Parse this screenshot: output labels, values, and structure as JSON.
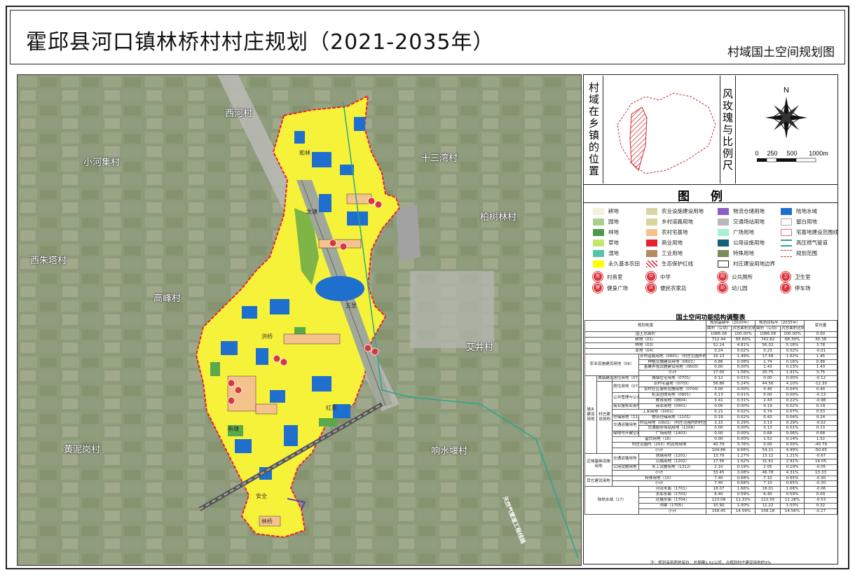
{
  "title": "霍邱县河口镇林桥村村庄规划（2021-2035年）",
  "subtitle": "村域国土空间规划图",
  "map": {
    "places": [
      "西河村",
      "小河集村",
      "十三湾村",
      "柏树林村",
      "西朱塔村",
      "高峰村",
      "艾井村",
      "黄泥岗村",
      "响水堰村"
    ],
    "inner_labels": [
      "和林",
      "龙塘",
      "五里",
      "洪桥",
      "新塘",
      "红星",
      "安全",
      "林桥"
    ],
    "highway_label": "天然气管道工程线路",
    "colors": {
      "farmland": "#ffff00",
      "water": "#1f6fcf",
      "forest": "#5aa94a",
      "homestead": "#f6c28b",
      "boundary": "#e8212e"
    }
  },
  "side": {
    "location_label": "村域在乡镇的位置",
    "compass_label": "风玫瑰与比例尺",
    "north": "N",
    "scale": [
      "0",
      "250",
      "500",
      "1000m"
    ]
  },
  "legend": {
    "title": "图例",
    "items": [
      {
        "label": "耕地",
        "color": "#f3f1d7"
      },
      {
        "label": "园地",
        "color": "#a7d08c"
      },
      {
        "label": "林地",
        "color": "#4d9a4d"
      },
      {
        "label": "草地",
        "color": "#c5e86c"
      },
      {
        "label": "湿地",
        "color": "#55c3a8"
      },
      {
        "label": "永久基本农田",
        "color": "#ffff00"
      },
      {
        "label": "农业设施建设用地",
        "color": "#d8d3a3"
      },
      {
        "label": "乡村道路用地",
        "color": "#d6d59e"
      },
      {
        "label": "农村宅基地",
        "color": "#f6c28b"
      },
      {
        "label": "商业用地",
        "color": "#e8212e"
      },
      {
        "label": "工业用地",
        "color": "#b48a64"
      },
      {
        "label": "生态保护红线",
        "color": "hatch"
      },
      {
        "label": "物流仓储用地",
        "color": "#8e5cc7"
      },
      {
        "label": "交通场站用地",
        "color": "#b8b8b8"
      },
      {
        "label": "广场用地",
        "color": "#a6f0d4"
      },
      {
        "label": "公用设施用地",
        "color": "#11627a"
      },
      {
        "label": "特殊用地",
        "color": "#7a8c5a"
      },
      {
        "label": "村庄建设用地边界",
        "color": "outline"
      },
      {
        "label": "陆地水域",
        "color": "#1f6fcf"
      },
      {
        "label": "留白用地",
        "color": "#ffffff"
      },
      {
        "label": "宅基地建设范围线",
        "color": "pinkoutline"
      },
      {
        "label": "高压燃气管道",
        "color": "#2aa58f"
      },
      {
        "label": "规划范围",
        "color": "redline"
      }
    ],
    "icons": [
      {
        "label": "村务室",
        "glyph": "务"
      },
      {
        "label": "中学",
        "glyph": "中"
      },
      {
        "label": "公共厕所",
        "glyph": "厕"
      },
      {
        "label": "卫生室",
        "glyph": "卫"
      },
      {
        "label": "健身广场",
        "glyph": "健"
      },
      {
        "label": "便民农家店",
        "glyph": "店"
      },
      {
        "label": "幼儿园",
        "glyph": "幼"
      },
      {
        "label": "停车场",
        "glyph": "P"
      }
    ]
  },
  "table": {
    "title": "国土空间功能结构调整表",
    "header_top": [
      "规划地类",
      "规划基期年（2020年）",
      "",
      "规划目标年（2035年）",
      "",
      "变化量"
    ],
    "header_sub": [
      "",
      "面积（公顷）",
      "占总面积比例（%）",
      "面积（公顷）",
      "占总面积比例（%）",
      ""
    ],
    "rows": [
      [
        "国土总面积",
        "1086.08",
        "100.00%",
        "1086.08",
        "100.00%",
        "0.00"
      ],
      [
        "耕地（01）",
        "712.44",
        "65.60%",
        "742.82",
        "68.39%",
        "30.38"
      ],
      [
        "林地（03）",
        "52.24",
        "4.81%",
        "56.02",
        "5.16%",
        "3.78"
      ],
      [
        "草地（04）",
        "0.24",
        "0.02%",
        "0.23",
        "0.02%",
        "-0.01"
      ],
      [
        "乡村道路用地（0601）（村庄范围外的道路用地）",
        "16.13",
        "1.49%",
        "17.58",
        "1.62%",
        "1.45"
      ],
      [
        "种植设施建设用地（0602）",
        "0.86",
        "0.08%",
        "1.74",
        "0.16%",
        "0.88"
      ],
      [
        "畜禽养殖设施建设用地（0603）",
        "0.00",
        "0.00%",
        "1.43",
        "0.13%",
        "1.43"
      ],
      [
        "小计",
        "17.00",
        "1.56%",
        "20.75",
        "1.91%",
        "3.75"
      ],
      [
        "城镇住宅用地（0701）",
        "0.12",
        "0.01%",
        "0.00",
        "0.00%",
        "-0.12"
      ],
      [
        "农村宅基地（0703）",
        "56.86",
        "5.24%",
        "44.56",
        "4.10%",
        "-12.30"
      ],
      [
        "农村社区服务设施用地（0704）",
        "0.00",
        "0.00%",
        "0.40",
        "0.04%",
        "0.40"
      ],
      [
        "机关团体用地（0801）",
        "0.13",
        "0.01%",
        "0.00",
        "0.00%",
        "-0.13"
      ],
      [
        "教育用地（0804）",
        "3.41",
        "0.31%",
        "2.43",
        "0.22%",
        "-0.98"
      ],
      [
        "商业用地（0901）",
        "0.00",
        "0.00%",
        "0.19",
        "0.02%",
        "0.19"
      ],
      [
        "工业用地（1001）",
        "0.21",
        "0.02%",
        "0.74",
        "0.07%",
        "0.53"
      ],
      [
        "物流仓储用地（1101）",
        "0.19",
        "0.02%",
        "0.43",
        "0.04%",
        "0.24"
      ],
      [
        "村道用地（0601）（村庄范围内的村庄内部道路用地）",
        "3.15",
        "0.29%",
        "3.13",
        "0.29%",
        "-0.02"
      ],
      [
        "交通服务场站用地（1208）",
        "0.00",
        "0.00%",
        "0.13",
        "0.01%",
        "0.13"
      ],
      [
        "广场用地（1403）",
        "0.00",
        "0.00%",
        "0.68",
        "0.06%",
        "0.68"
      ],
      [
        "留白用地（16）",
        "0.00",
        "0.00%",
        "1.52",
        "0.14%",
        "1.52"
      ],
      [
        "村庄范围内（203）的其他用地",
        "40.79",
        "3.76%",
        "0.00",
        "0.00%",
        "-40.79"
      ],
      [
        "小计",
        "104.86",
        "9.66%",
        "54.21",
        "4.99%",
        "-50.65"
      ],
      [
        "铁路用地（1201）",
        "13.79",
        "1.27%",
        "13.12",
        "1.21%",
        "-0.67"
      ],
      [
        "公路用地（1202）",
        "17.56",
        "1.62%",
        "31.61",
        "2.91%",
        "14.05"
      ],
      [
        "水工设施用地（1312）",
        "2.10",
        "0.19%",
        "2.05",
        "0.19%",
        "-0.05"
      ],
      [
        "小计",
        "33.45",
        "3.08%",
        "46.78",
        "4.31%",
        "13.33"
      ],
      [
        "特殊用地（15）",
        "7.40",
        "0.68%",
        "7.10",
        "0.65%",
        "-0.30"
      ],
      [
        "小计",
        "7.40",
        "0.68%",
        "7.10",
        "0.65%",
        "-0.30"
      ],
      [
        "河流水面（1701）",
        "18.07",
        "1.66%",
        "18.01",
        "1.66%",
        "-0.06"
      ],
      [
        "水库水面（1703）",
        "6.40",
        "0.59%",
        "6.40",
        "0.59%",
        "0.00"
      ],
      [
        "坑塘水面（1704）",
        "123.08",
        "11.33%",
        "122.55",
        "11.28%",
        "-0.53"
      ],
      [
        "沟渠（1705）",
        "10.90",
        "1.00%",
        "11.22",
        "1.03%",
        "0.32"
      ],
      [
        "小计",
        "158.45",
        "14.59%",
        "158.18",
        "14.56%",
        "-0.27"
      ]
    ],
    "groups": {
      "agri": "农业设施建设用地（06）",
      "urban": "城镇建设用地",
      "resid1": "居住用地（07）",
      "resid2": "居住用地（07）",
      "village": "村庄建设用地",
      "public": "公共管理与公共服务用地（08）",
      "commerce": "商业服务业用地（09）",
      "logistics": "仓储用地（11）",
      "transport": "交通运输用地（12）",
      "green": "绿地与开敞空间用地（14）",
      "urbanrural": "城乡建设用地",
      "regional": "区域基础设施用地",
      "rtransport": "交通运输用地（12）",
      "utility": "公用设施用地（13）",
      "other": "其它建设用地",
      "water": "陆地水域（17）"
    },
    "note": "注：规划采用两地留白，总规模1.52公顷，占规划村庄建设用地的3%"
  }
}
